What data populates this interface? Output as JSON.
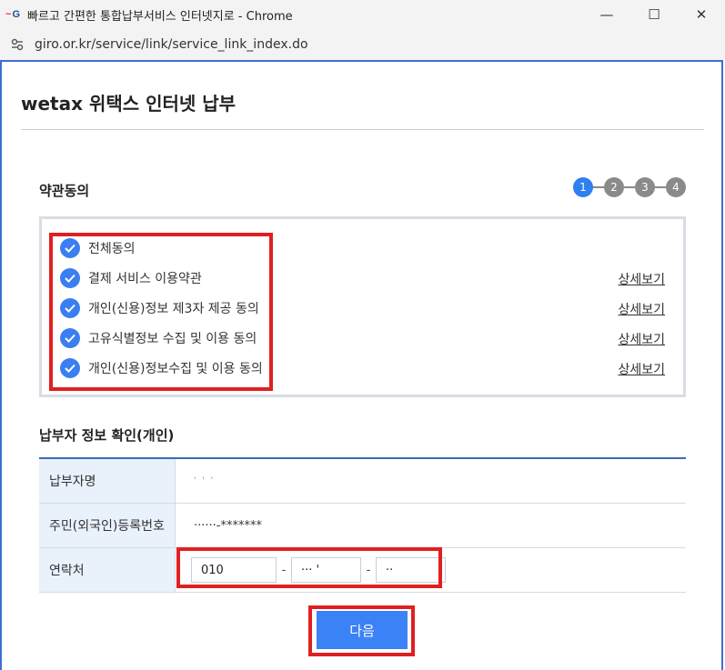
{
  "browser": {
    "tab_title": "빠르고 간편한 통합납부서비스 인터넷지로 - Chrome",
    "url": "giro.or.kr/service/link/service_link_index.do",
    "controls": {
      "minimize": "—",
      "maximize": "☐",
      "close": "✕"
    }
  },
  "page": {
    "title": "wetax 위택스 인터넷 납부",
    "terms_section_title": "약관동의",
    "steps": [
      "1",
      "2",
      "3",
      "4"
    ],
    "active_step": 1,
    "terms": [
      {
        "label": "전체동의",
        "detail": ""
      },
      {
        "label": "결제 서비스 이용약관",
        "detail": "상세보기"
      },
      {
        "label": "개인(신용)정보 제3자 제공 동의",
        "detail": "상세보기"
      },
      {
        "label": "고유식별정보 수집 및 이용 동의",
        "detail": "상세보기"
      },
      {
        "label": "개인(신용)정보수집 및 이용 동의",
        "detail": "상세보기"
      }
    ],
    "payer_section_title": "납부자 정보 확인(개인)",
    "payer_rows": {
      "name_label": "납부자명",
      "name_value": "' ' '",
      "rrn_label": "주민(외국인)등록번호",
      "rrn_value": "······-*******",
      "phone_label": "연락처",
      "phone_1": "010",
      "phone_2": "··· '",
      "phone_3": "··",
      "phone_sep": "-"
    },
    "next_button": "다음"
  },
  "colors": {
    "accent": "#3a82f5",
    "highlight": "#e02020",
    "step_inactive": "#8a8a8a"
  }
}
